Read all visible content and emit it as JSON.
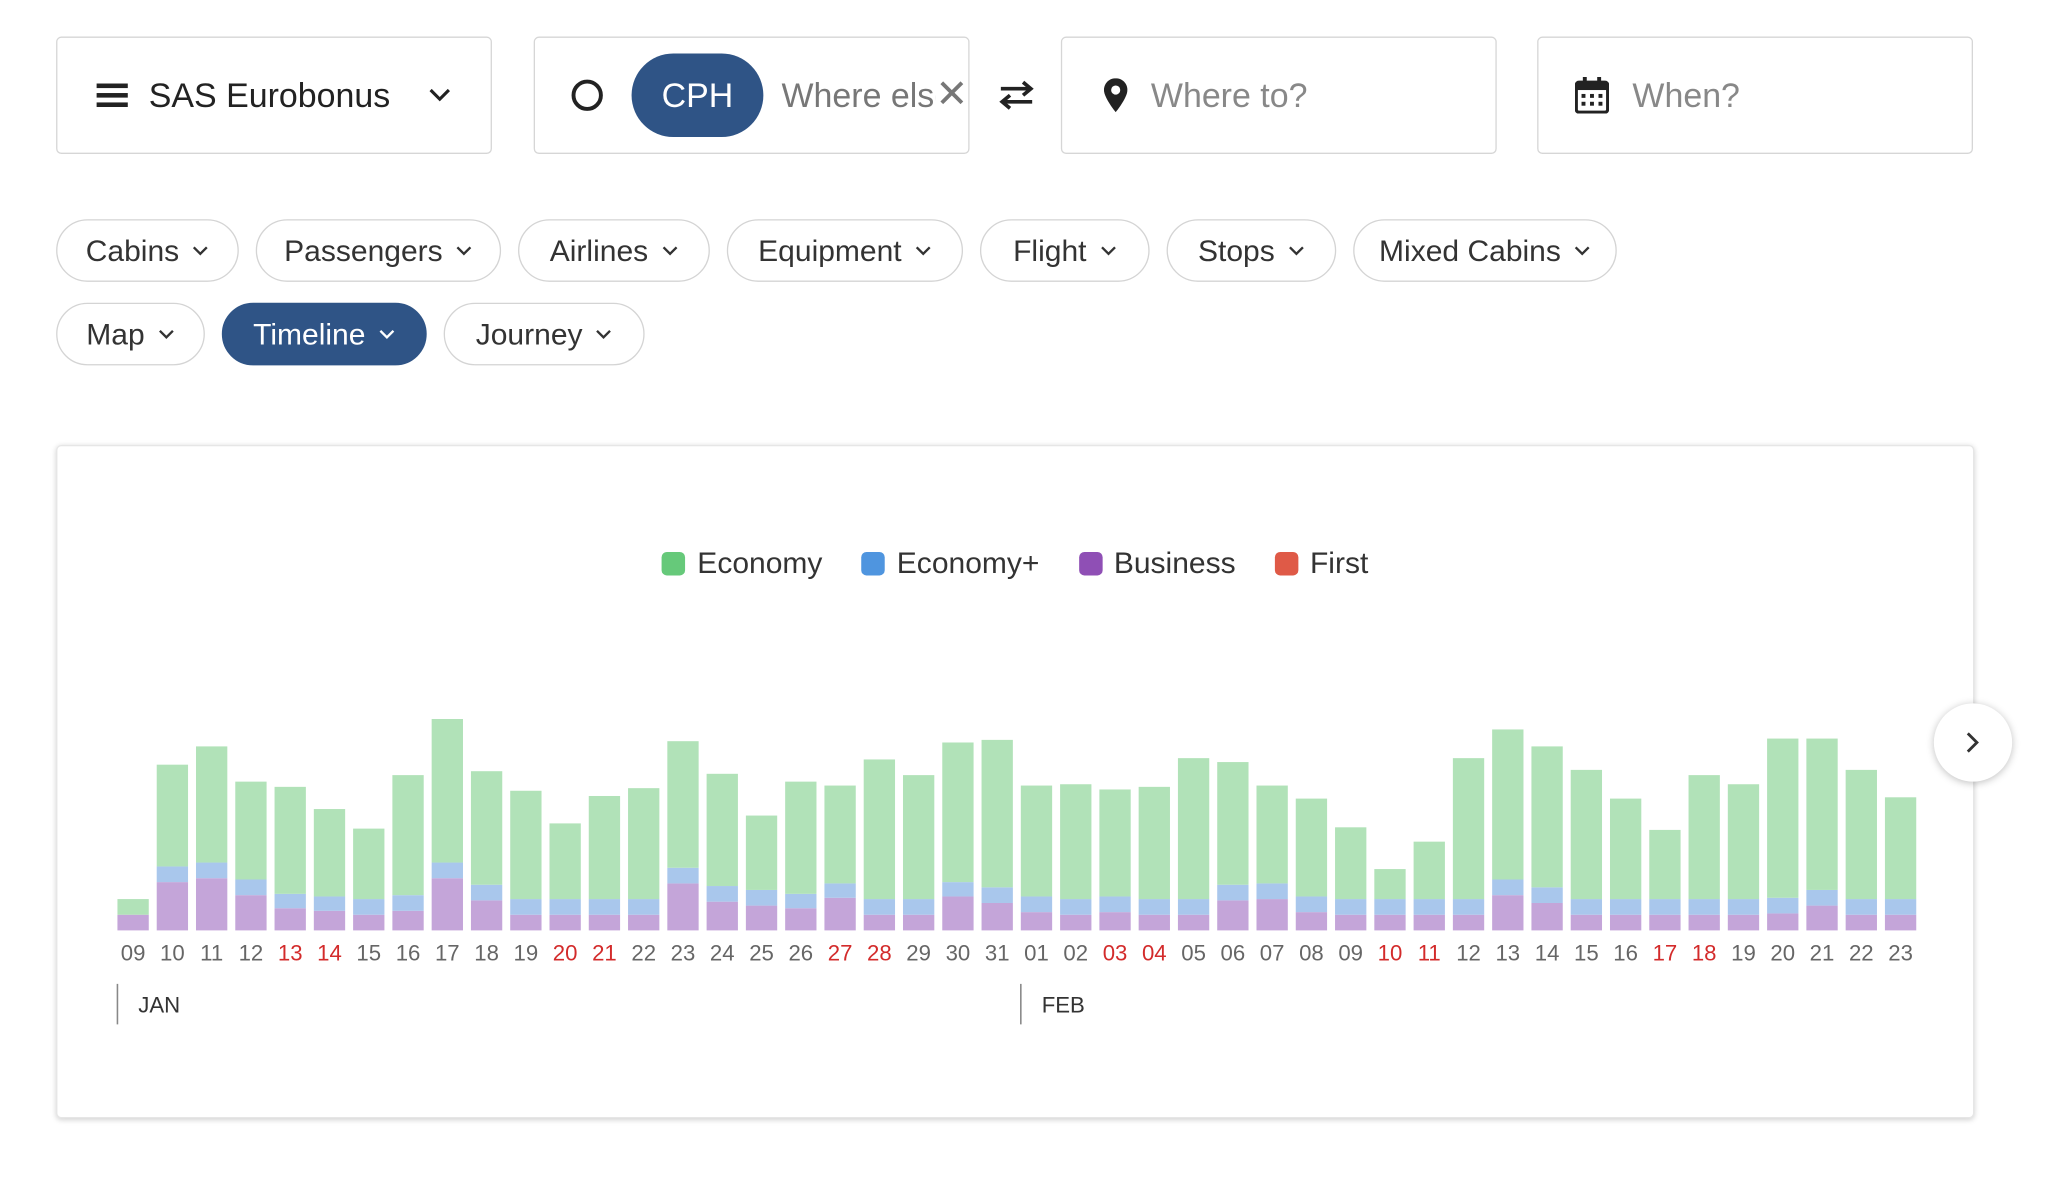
{
  "search": {
    "program": "SAS Eurobonus",
    "origin_code": "CPH",
    "origin_placeholder": "Where else?",
    "destination_placeholder": "Where to?",
    "date_placeholder": "When?"
  },
  "filters": [
    {
      "label": "Cabins"
    },
    {
      "label": "Passengers"
    },
    {
      "label": "Airlines"
    },
    {
      "label": "Equipment"
    },
    {
      "label": "Flight"
    },
    {
      "label": "Stops"
    },
    {
      "label": "Mixed Cabins"
    },
    {
      "label": "Map"
    },
    {
      "label": "Timeline",
      "active": true
    },
    {
      "label": "Journey"
    }
  ],
  "colors": {
    "accent": "#2f5486",
    "economy": "#b1e2b8",
    "economy_plus": "#a9c7ec",
    "business": "#c4a5d9",
    "weekend_text": "#d32b2b"
  },
  "chart_data": {
    "type": "bar",
    "stacked": true,
    "legend": [
      {
        "name": "Economy",
        "color": "#66c97a"
      },
      {
        "name": "Economy+",
        "color": "#4f95df"
      },
      {
        "name": "Business",
        "color": "#8f4fb5"
      },
      {
        "name": "First",
        "color": "#df5a47"
      }
    ],
    "categories": [
      "09",
      "10",
      "11",
      "12",
      "13",
      "14",
      "15",
      "16",
      "17",
      "18",
      "19",
      "20",
      "21",
      "22",
      "23",
      "24",
      "25",
      "26",
      "27",
      "28",
      "29",
      "30",
      "31",
      "01",
      "02",
      "03",
      "04",
      "05",
      "06",
      "07",
      "08",
      "09",
      "10",
      "11",
      "12",
      "13",
      "14",
      "15",
      "16",
      "17",
      "18",
      "19",
      "20",
      "21",
      "22",
      "23"
    ],
    "weekend": [
      false,
      false,
      false,
      false,
      true,
      true,
      false,
      false,
      false,
      false,
      false,
      true,
      true,
      false,
      false,
      false,
      false,
      false,
      true,
      true,
      false,
      false,
      false,
      false,
      false,
      true,
      true,
      false,
      false,
      false,
      false,
      false,
      true,
      true,
      false,
      false,
      false,
      false,
      false,
      true,
      true,
      false,
      false,
      false,
      false,
      false
    ],
    "months": [
      {
        "label": "JAN",
        "start_index": 0
      },
      {
        "label": "FEB",
        "start_index": 23
      }
    ],
    "series": [
      {
        "name": "Business",
        "values": [
          12,
          37,
          40,
          27,
          17,
          15,
          12,
          15,
          40,
          23,
          12,
          12,
          12,
          12,
          36,
          22,
          19,
          17,
          25,
          12,
          12,
          26,
          21,
          14,
          12,
          14,
          12,
          12,
          23,
          24,
          14,
          12,
          12,
          12,
          12,
          27,
          21,
          12,
          12,
          12,
          12,
          12,
          13,
          19,
          12,
          12
        ]
      },
      {
        "name": "Economy+",
        "values": [
          0,
          12,
          12,
          12,
          11,
          11,
          12,
          12,
          12,
          12,
          12,
          12,
          12,
          12,
          12,
          12,
          12,
          11,
          11,
          12,
          12,
          11,
          12,
          12,
          12,
          12,
          12,
          12,
          12,
          12,
          12,
          12,
          12,
          12,
          12,
          12,
          12,
          12,
          12,
          12,
          12,
          12,
          12,
          12,
          12,
          12
        ]
      },
      {
        "name": "Economy",
        "values": [
          12,
          78,
          89,
          75,
          82,
          67,
          54,
          92,
          110,
          87,
          83,
          58,
          79,
          85,
          97,
          86,
          57,
          86,
          75,
          107,
          95,
          107,
          113,
          85,
          88,
          82,
          86,
          108,
          94,
          75,
          75,
          55,
          23,
          44,
          108,
          115,
          108,
          99,
          77,
          53,
          95,
          88,
          122,
          116,
          99,
          78
        ]
      },
      {
        "name": "First",
        "values": [
          0,
          0,
          0,
          0,
          0,
          0,
          0,
          0,
          0,
          0,
          0,
          0,
          0,
          0,
          0,
          0,
          0,
          0,
          0,
          0,
          0,
          0,
          0,
          0,
          0,
          0,
          0,
          0,
          0,
          0,
          0,
          0,
          0,
          0,
          0,
          0,
          0,
          0,
          0,
          0,
          0,
          0,
          0,
          0,
          0,
          0
        ]
      }
    ]
  }
}
